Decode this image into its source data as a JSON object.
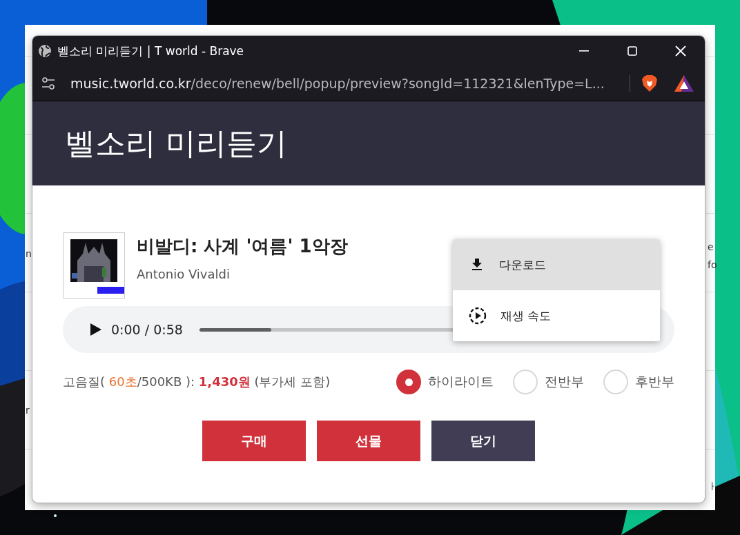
{
  "background_page": {
    "left_edge_texts": [
      "n",
      "r"
    ],
    "right_edge_texts": [
      "e",
      "fo",
      "ㅏ"
    ]
  },
  "window": {
    "title": "벨소리 미리듣기 | T world - Brave",
    "address_host": "music.tworld.co.kr",
    "address_path": "/deco/renew/bell/popup/preview?songId=112321&lenType=L..."
  },
  "header": {
    "title": "벨소리 미리듣기"
  },
  "song": {
    "title": "비발디: 사계 '여름' 1악장",
    "artist": "Antonio Vivaldi"
  },
  "player": {
    "time": "0:00 / 0:58",
    "level": 0.16
  },
  "menu": [
    {
      "kind": "download",
      "label": "다운로드",
      "highlighted": true
    },
    {
      "kind": "speed",
      "label": "재생 속도",
      "highlighted": false
    }
  ],
  "price_line": [
    {
      "kind": "plain",
      "text": "고음질( "
    },
    {
      "kind": "accent",
      "text": "60초"
    },
    {
      "kind": "plain",
      "text": "/500KB ): "
    },
    {
      "kind": "price",
      "text": "1,430원"
    },
    {
      "kind": "plain",
      "text": " (부가세 포함)"
    }
  ],
  "ranges": [
    {
      "label": "하이라이트",
      "selected": true
    },
    {
      "label": "전반부",
      "selected": false
    },
    {
      "label": "후반부",
      "selected": false
    }
  ],
  "buttons": [
    {
      "kind": "primary",
      "label": "구매"
    },
    {
      "kind": "primary",
      "label": "선물"
    },
    {
      "kind": "dark",
      "label": "닫기"
    }
  ]
}
